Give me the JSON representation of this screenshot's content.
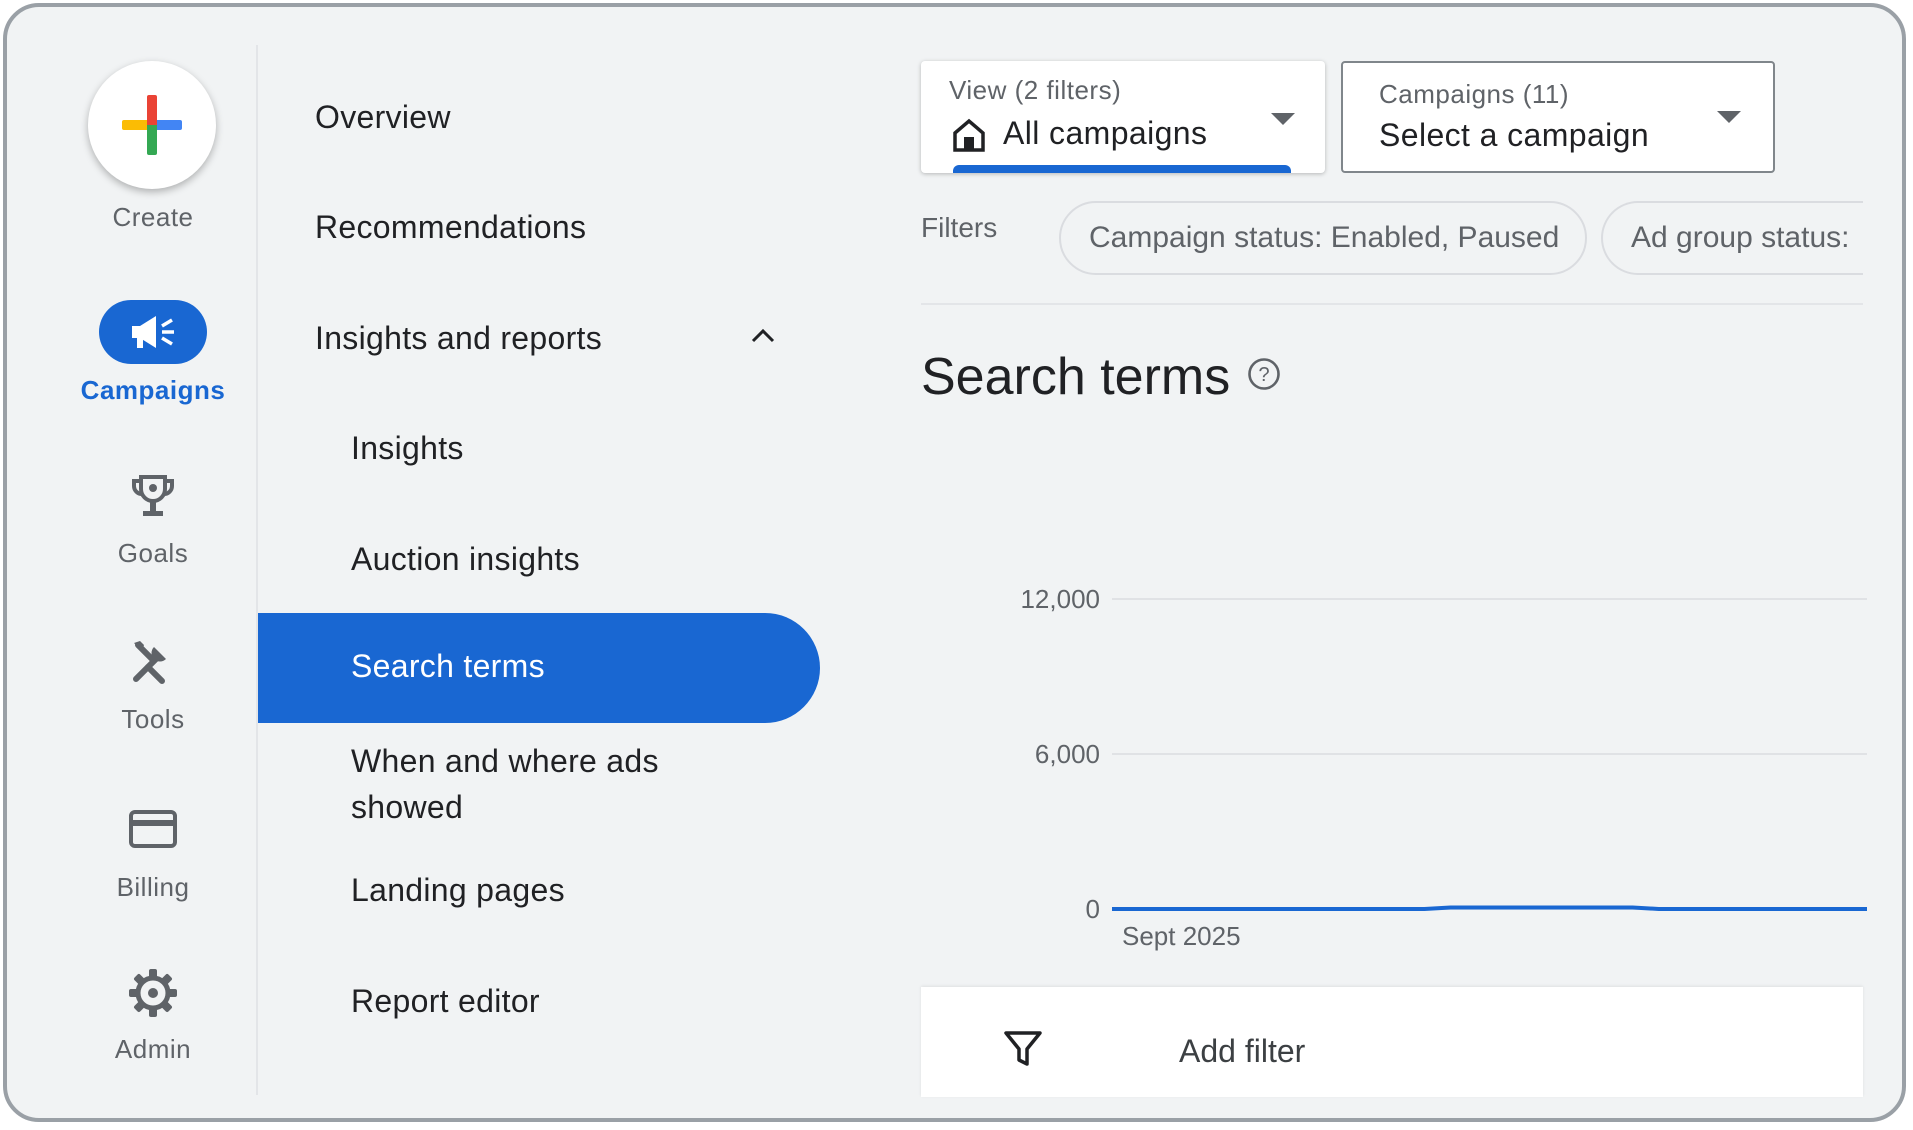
{
  "rail": {
    "create": "Create",
    "campaigns": "Campaigns",
    "goals": "Goals",
    "tools": "Tools",
    "billing": "Billing",
    "admin": "Admin"
  },
  "nav": {
    "overview": "Overview",
    "recommendations": "Recommendations",
    "insights_and_reports": "Insights and reports",
    "insights": "Insights",
    "auction_insights": "Auction insights",
    "search_terms": "Search terms",
    "when_where_line1": "When and where ads",
    "when_where_line2": "showed",
    "landing_pages": "Landing pages",
    "report_editor": "Report editor"
  },
  "view_selector": {
    "label": "View (2 filters)",
    "value": "All campaigns"
  },
  "campaign_selector": {
    "label": "Campaigns (11)",
    "value": "Select a campaign"
  },
  "filters": {
    "label": "Filters",
    "chips": [
      "Campaign status: Enabled, Paused",
      "Ad group status:"
    ]
  },
  "page_title": "Search terms",
  "chart_data": {
    "type": "line",
    "x": [
      "Sept 2025"
    ],
    "yticks": [
      "12,000",
      "6,000",
      "0"
    ],
    "ylim": [
      0,
      12000
    ],
    "series": [
      {
        "values": [
          0,
          0,
          0,
          0,
          0,
          0,
          0,
          0,
          0,
          0,
          0,
          0,
          0,
          0,
          0,
          0,
          0,
          0,
          0,
          0,
          0,
          0,
          0,
          0,
          0,
          0,
          0,
          0,
          0,
          0
        ]
      }
    ],
    "grid": true,
    "colors": {
      "line": "#1967d2",
      "grid": "#dadce0"
    }
  },
  "add_filter": "Add filter",
  "colors": {
    "accent": "#1967d2",
    "background": "#f1f3f4"
  }
}
